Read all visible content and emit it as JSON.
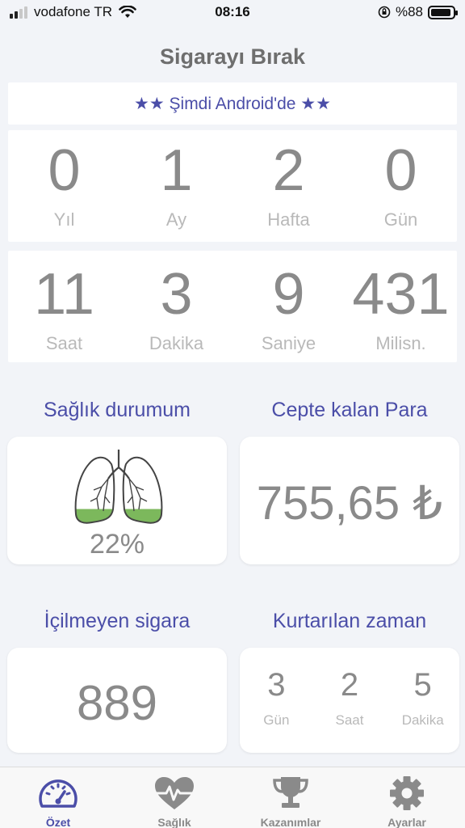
{
  "status_bar": {
    "carrier": "vodafone TR",
    "time": "08:16",
    "battery": "%88"
  },
  "app": {
    "title": "Sigarayı Bırak",
    "banner": "★★ Şimdi Android'de ★★"
  },
  "duration_top": [
    {
      "value": "0",
      "label": "Yıl"
    },
    {
      "value": "1",
      "label": "Ay"
    },
    {
      "value": "2",
      "label": "Hafta"
    },
    {
      "value": "0",
      "label": "Gün"
    }
  ],
  "duration_bottom": [
    {
      "value": "11",
      "label": "Saat"
    },
    {
      "value": "3",
      "label": "Dakika"
    },
    {
      "value": "9",
      "label": "Saniye"
    },
    {
      "value": "431",
      "label": "Milisn."
    }
  ],
  "health": {
    "title": "Sağlık durumum",
    "percent": "22%",
    "lung_fill": 0.22,
    "lung_fill_color": "#7cb85c"
  },
  "money": {
    "title": "Cepte kalan Para",
    "value": "755,65 ₺"
  },
  "cigarettes": {
    "title": "İçilmeyen sigara",
    "value": "889"
  },
  "saved_time": {
    "title": "Kurtarılan zaman",
    "items": [
      {
        "value": "3",
        "label": "Gün"
      },
      {
        "value": "2",
        "label": "Saat"
      },
      {
        "value": "5",
        "label": "Dakika"
      }
    ]
  },
  "tabs": [
    {
      "label": "Özet",
      "icon": "speedometer-icon",
      "active": true
    },
    {
      "label": "Sağlık",
      "icon": "heartbeat-icon",
      "active": false
    },
    {
      "label": "Kazanımlar",
      "icon": "trophy-icon",
      "active": false
    },
    {
      "label": "Ayarlar",
      "icon": "gear-icon",
      "active": false
    }
  ],
  "colors": {
    "accent": "#4b4ea8",
    "background": "#f2f4f8",
    "value_text": "#8a8a8a",
    "label_text": "#b9b9b9"
  }
}
